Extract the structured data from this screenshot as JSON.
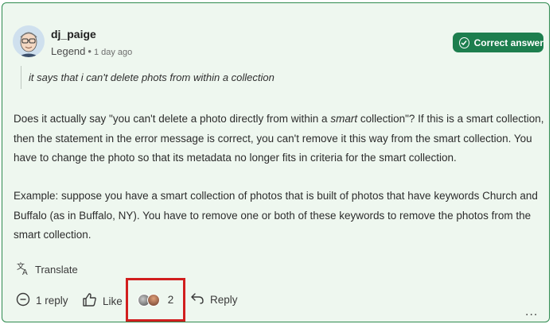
{
  "post": {
    "author": "dj_paige",
    "rank": "Legend",
    "separator": "•",
    "time": "1 day ago",
    "badge": "Correct answer",
    "quote": "it says that i can't  delete phots from within a collection",
    "paragraph1": {
      "before": "Does it actually say \"you can't delete a photo directly from within a ",
      "emph": "smart",
      "after": " collection\"? If this is a smart collection, then the statement in the error message is correct, you can't remove it this way from the smart collection. You have to change the photo so that its metadata no longer fits in criteria for the smart collection."
    },
    "paragraph2": "Example: suppose you have a smart collection of photos that is built of photos that have keywords Church and Buffalo (as in Buffalo, NY). You have to remove one or both of these keywords to remove the photos from the smart collection."
  },
  "actions": {
    "translate": "Translate",
    "reply_count": "1 reply",
    "like": "Like",
    "likes_count": "2",
    "reply": "Reply",
    "more": "..."
  },
  "colors": {
    "card_bg": "#eef7ef",
    "card_border": "#2d8a4e",
    "badge_bg": "#1d7e4e",
    "highlight": "#d11e1e"
  },
  "icons": [
    "avatar",
    "check-circle-icon",
    "translate-icon",
    "minus-circle-icon",
    "thumbs-up-icon",
    "liker-avatars",
    "reply-arrow-icon",
    "more-icon"
  ]
}
